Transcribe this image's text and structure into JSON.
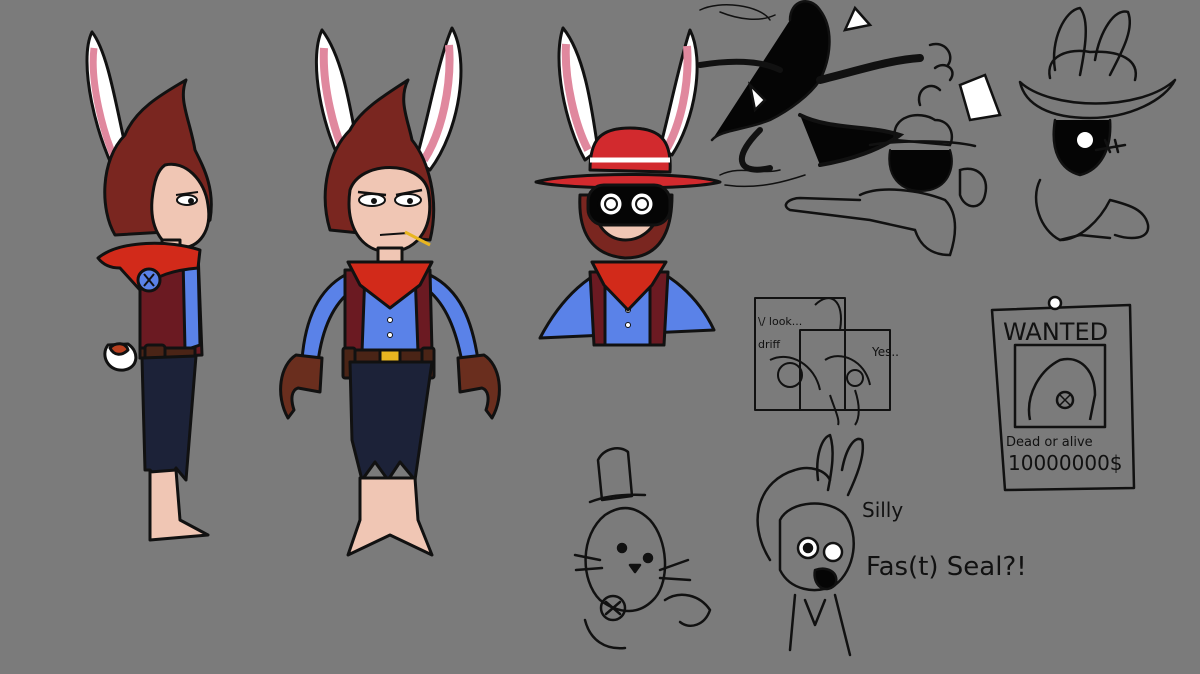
{
  "colors": {
    "background": "#7b7b7b",
    "hair": "#7a2620",
    "skin": "#f0c6b4",
    "bandana": "#d22a1a",
    "shirt": "#5a82e8",
    "vest": "#6b1a22",
    "pants": "#1c2238",
    "gloves": "#6a2e1e",
    "ear_outer": "#ffffff",
    "ear_inner": "#e0889e",
    "hat_red": "#d2282e",
    "mask": "#050505"
  },
  "icons": {
    "side_view": "bunny-cowboy-side-view",
    "front_view": "bunny-cowboy-front-view",
    "masked_view": "bunny-cowboy-masked-hat-bust",
    "action_sketch": "black-silhouette-action-sketch",
    "hat_sketch": "cowboy-hat-bust-sketch",
    "comic_sketch": "two-panel-comic-sketch",
    "wanted_poster": "wanted-poster-sketch",
    "top_hat_seal": "top-hat-seal-sketch",
    "gasmask_bunny": "gasmask-bunny-sketch",
    "vest_emblem": "x-emblem"
  },
  "texts": {
    "comic_line_1": "\\/ look...",
    "comic_line_2": "driff",
    "comic_line_3": "Yes..",
    "wanted_title": "WANTED",
    "wanted_sub": "Dead or alive",
    "wanted_amount": "10000000$",
    "silly": "Silly",
    "fast_seal": "Fas(t) Seal?!"
  }
}
